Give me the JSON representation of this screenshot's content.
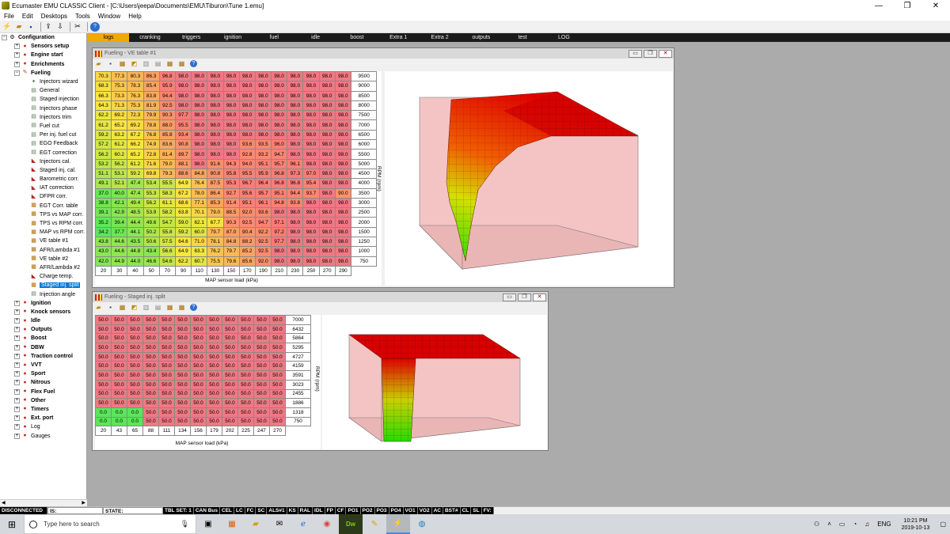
{
  "window": {
    "title": "Ecumaster EMU CLASSIC Client - [C:\\Users\\jeepa\\Documents\\EMU\\Tiburon\\Tune 1.emu]",
    "minimize": "—",
    "maximize": "❐",
    "close": "✕"
  },
  "menu": [
    "File",
    "Edit",
    "Desktops",
    "Tools",
    "Window",
    "Help"
  ],
  "tree": {
    "root": "Configuration",
    "items": [
      {
        "label": "Sensors setup",
        "bold": true,
        "level": 1,
        "icon": "sensor-icon"
      },
      {
        "label": "Engine start",
        "bold": true,
        "level": 1,
        "icon": "engine-icon"
      },
      {
        "label": "Enrichments",
        "bold": true,
        "level": 1,
        "icon": "enrich-icon"
      },
      {
        "label": "Fueling",
        "bold": true,
        "level": 1,
        "icon": "fuel-icon",
        "expanded": true
      },
      {
        "label": "Injectors wizard",
        "level": 2,
        "icon": "wand-icon"
      },
      {
        "label": "General",
        "level": 2,
        "icon": "page-icon"
      },
      {
        "label": "Staged injection",
        "level": 2,
        "icon": "page-icon"
      },
      {
        "label": "Injectors phase",
        "level": 2,
        "icon": "page-icon"
      },
      {
        "label": "Injectors trim",
        "level": 2,
        "icon": "page-icon"
      },
      {
        "label": "Fuel cut",
        "level": 2,
        "icon": "page-icon"
      },
      {
        "label": "Per inj. fuel cut",
        "level": 2,
        "icon": "page-icon"
      },
      {
        "label": "EGO Feedback",
        "level": 2,
        "icon": "page-icon"
      },
      {
        "label": "EGT correction",
        "level": 2,
        "icon": "page-icon"
      },
      {
        "label": "Injectors cal.",
        "level": 2,
        "icon": "curve-icon"
      },
      {
        "label": "Staged inj. cal.",
        "level": 2,
        "icon": "curve-icon"
      },
      {
        "label": "Barometric corr.",
        "level": 2,
        "icon": "curve-icon"
      },
      {
        "label": "IAT correction",
        "level": 2,
        "icon": "curve-icon"
      },
      {
        "label": "DFPR corr.",
        "level": 2,
        "icon": "curve-icon"
      },
      {
        "label": "EGT Corr. table",
        "level": 2,
        "icon": "table-icon"
      },
      {
        "label": "TPS vs MAP corr.",
        "level": 2,
        "icon": "table-icon"
      },
      {
        "label": "TPS vs RPM corr.",
        "level": 2,
        "icon": "table-icon"
      },
      {
        "label": "MAP vs RPM corr.",
        "level": 2,
        "icon": "table-icon"
      },
      {
        "label": "VE table #1",
        "level": 2,
        "icon": "table-icon"
      },
      {
        "label": "AFR/Lambda #1",
        "level": 2,
        "icon": "table-icon"
      },
      {
        "label": "VE table #2",
        "level": 2,
        "icon": "table-icon"
      },
      {
        "label": "AFR/Lambda #2",
        "level": 2,
        "icon": "table-icon"
      },
      {
        "label": "Charge temp.",
        "level": 2,
        "icon": "curve-icon"
      },
      {
        "label": "Staged inj. split",
        "level": 2,
        "icon": "table-icon",
        "selected": true
      },
      {
        "label": "Injection angle",
        "level": 2,
        "icon": "page-icon"
      },
      {
        "label": "Ignition",
        "bold": true,
        "level": 1,
        "icon": "spark-icon"
      },
      {
        "label": "Knock sensors",
        "bold": true,
        "level": 1,
        "icon": "knock-icon"
      },
      {
        "label": "Idle",
        "bold": true,
        "level": 1,
        "icon": "idle-icon"
      },
      {
        "label": "Outputs",
        "bold": true,
        "level": 1,
        "icon": "output-icon"
      },
      {
        "label": "Boost",
        "bold": true,
        "level": 1,
        "icon": "boost-icon"
      },
      {
        "label": "DBW",
        "bold": true,
        "level": 1,
        "icon": "dbw-icon"
      },
      {
        "label": "Traction control",
        "bold": true,
        "level": 1,
        "icon": "traction-icon"
      },
      {
        "label": "VVT",
        "bold": true,
        "level": 1,
        "icon": "vvt-icon"
      },
      {
        "label": "Sport",
        "bold": true,
        "level": 1,
        "icon": "sport-icon"
      },
      {
        "label": "Nitrous",
        "bold": true,
        "level": 1,
        "icon": "nitrous-icon"
      },
      {
        "label": "Flex Fuel",
        "bold": true,
        "level": 1,
        "icon": "flex-icon"
      },
      {
        "label": "Other",
        "bold": true,
        "level": 1,
        "icon": "other-icon"
      },
      {
        "label": "Timers",
        "bold": true,
        "level": 1,
        "icon": "timer-icon"
      },
      {
        "label": "Ext. port",
        "bold": true,
        "level": 1,
        "icon": "port-icon"
      },
      {
        "label": "Log",
        "bold": false,
        "level": 1,
        "icon": "log-icon"
      },
      {
        "label": "Gauges",
        "bold": false,
        "level": 1,
        "icon": "gauge-icon"
      }
    ]
  },
  "tabs": [
    "logs",
    "cranking",
    "triggers",
    "ignition",
    "fuel",
    "idle",
    "boost",
    "Extra 1",
    "Extra 2",
    "outputs",
    "test",
    "LOG"
  ],
  "active_tab": 0,
  "ve_window": {
    "title": "Fueling - VE table #1",
    "xlabel": "MAP sensor load (kPa)",
    "ylabel": "RPM (rpm)",
    "rpm": [
      "9500",
      "9000",
      "8500",
      "8000",
      "7500",
      "7000",
      "6500",
      "6000",
      "5500",
      "5000",
      "4500",
      "4000",
      "3500",
      "3000",
      "2500",
      "2000",
      "1500",
      "1250",
      "1000",
      "750"
    ],
    "load": [
      "20",
      "30",
      "40",
      "50",
      "70",
      "90",
      "110",
      "130",
      "150",
      "170",
      "190",
      "210",
      "230",
      "250",
      "270",
      "290"
    ],
    "rows": [
      [
        "70.3",
        "77.3",
        "80.3",
        "86.3",
        "96.8",
        "98.0",
        "98.0",
        "98.0",
        "98.0",
        "98.0",
        "98.0",
        "98.0",
        "98.0",
        "98.0",
        "98.0",
        "98.0"
      ],
      [
        "68.3",
        "75.3",
        "78.3",
        "85.4",
        "95.9",
        "98.0",
        "98.0",
        "98.0",
        "98.0",
        "98.0",
        "98.0",
        "98.0",
        "98.0",
        "98.0",
        "98.0",
        "98.0"
      ],
      [
        "66.3",
        "73.3",
        "76.3",
        "83.8",
        "94.4",
        "98.0",
        "98.0",
        "98.0",
        "98.0",
        "98.0",
        "98.0",
        "98.0",
        "98.0",
        "98.0",
        "98.0",
        "98.0"
      ],
      [
        "64.3",
        "71.3",
        "75.3",
        "81.9",
        "92.5",
        "98.0",
        "98.0",
        "98.0",
        "98.0",
        "98.0",
        "98.0",
        "98.0",
        "98.0",
        "98.0",
        "98.0",
        "98.0"
      ],
      [
        "62.2",
        "69.2",
        "72.3",
        "79.9",
        "90.3",
        "97.7",
        "98.0",
        "98.0",
        "98.0",
        "98.0",
        "98.0",
        "98.0",
        "98.0",
        "98.0",
        "98.0",
        "98.0"
      ],
      [
        "61.2",
        "65.2",
        "69.2",
        "78.8",
        "88.0",
        "95.5",
        "98.0",
        "98.0",
        "98.0",
        "98.0",
        "98.0",
        "98.0",
        "98.0",
        "98.0",
        "98.0",
        "98.0"
      ],
      [
        "59.2",
        "63.2",
        "67.2",
        "76.8",
        "85.8",
        "93.4",
        "98.0",
        "98.0",
        "98.0",
        "98.0",
        "98.0",
        "98.0",
        "98.0",
        "98.0",
        "98.0",
        "98.0"
      ],
      [
        "57.2",
        "61.2",
        "66.2",
        "74.9",
        "83.6",
        "90.8",
        "98.0",
        "98.0",
        "98.0",
        "93.6",
        "93.5",
        "96.0",
        "98.0",
        "98.0",
        "98.0",
        "98.0"
      ],
      [
        "56.2",
        "60.2",
        "65.2",
        "72.8",
        "81.4",
        "89.7",
        "98.0",
        "98.0",
        "98.0",
        "92.8",
        "93.2",
        "94.7",
        "98.0",
        "98.0",
        "98.0",
        "98.0"
      ],
      [
        "53.2",
        "56.2",
        "61.2",
        "71.6",
        "79.0",
        "88.1",
        "98.0",
        "91.6",
        "94.3",
        "94.0",
        "95.1",
        "95.7",
        "96.1",
        "98.0",
        "98.0",
        "98.0"
      ],
      [
        "51.1",
        "53.1",
        "59.2",
        "69.8",
        "79.3",
        "88.6",
        "84.8",
        "90.8",
        "95.8",
        "95.5",
        "95.9",
        "96.8",
        "97.3",
        "97.0",
        "98.0",
        "98.0"
      ],
      [
        "49.1",
        "52.1",
        "47.4",
        "53.4",
        "55.5",
        "64.9",
        "76.4",
        "87.5",
        "95.3",
        "96.7",
        "96.4",
        "96.8",
        "96.8",
        "95.4",
        "98.0",
        "98.0"
      ],
      [
        "37.0",
        "40.0",
        "47.4",
        "55.3",
        "58.3",
        "67.2",
        "78.0",
        "86.4",
        "92.7",
        "95.6",
        "95.7",
        "95.1",
        "94.4",
        "93.7",
        "98.0",
        "90.0"
      ],
      [
        "38.8",
        "42.1",
        "49.4",
        "56.2",
        "61.1",
        "68.6",
        "77.1",
        "85.3",
        "91.4",
        "95.1",
        "96.1",
        "94.8",
        "93.8",
        "98.0",
        "98.0",
        "98.0"
      ],
      [
        "39.1",
        "42.9",
        "48.5",
        "53.9",
        "58.2",
        "63.8",
        "70.1",
        "79.0",
        "88.5",
        "92.0",
        "93.6",
        "98.0",
        "98.0",
        "98.0",
        "98.0",
        "98.0"
      ],
      [
        "35.2",
        "39.4",
        "44.4",
        "49.6",
        "54.7",
        "59.0",
        "62.1",
        "67.7",
        "90.3",
        "92.5",
        "94.7",
        "97.1",
        "98.0",
        "98.0",
        "98.0",
        "98.0"
      ],
      [
        "34.2",
        "37.7",
        "44.1",
        "50.2",
        "55.8",
        "59.2",
        "60.0",
        "79.7",
        "87.0",
        "90.4",
        "92.2",
        "97.2",
        "98.0",
        "98.0",
        "98.0",
        "98.0"
      ],
      [
        "43.8",
        "44.6",
        "43.5",
        "50.6",
        "57.5",
        "64.6",
        "71.0",
        "78.1",
        "84.8",
        "88.2",
        "92.5",
        "97.7",
        "98.0",
        "98.0",
        "98.0",
        "98.0"
      ],
      [
        "43.0",
        "44.6",
        "44.8",
        "43.4",
        "56.6",
        "64.9",
        "63.3",
        "76.2",
        "79.7",
        "85.2",
        "92.5",
        "98.0",
        "98.0",
        "98.0",
        "98.0",
        "98.0"
      ],
      [
        "42.0",
        "44.9",
        "44.0",
        "46.6",
        "54.6",
        "62.2",
        "60.7",
        "75.5",
        "79.6",
        "85.6",
        "92.0",
        "98.0",
        "98.0",
        "98.0",
        "98.0",
        "98.0"
      ]
    ]
  },
  "split_window": {
    "title": "Fueling - Staged inj. split",
    "xlabel": "MAP sensor load (kPa)",
    "ylabel": "RPM (rpm)",
    "rpm": [
      "7000",
      "6432",
      "5864",
      "5295",
      "4727",
      "4159",
      "3591",
      "3023",
      "2455",
      "1886",
      "1318",
      "750"
    ],
    "load": [
      "20",
      "43",
      "65",
      "88",
      "111",
      "134",
      "156",
      "179",
      "202",
      "225",
      "247",
      "270"
    ],
    "rows": [
      [
        "50.0",
        "50.0",
        "50.0",
        "50.0",
        "50.0",
        "50.0",
        "50.0",
        "50.0",
        "50.0",
        "50.0",
        "50.0",
        "50.0"
      ],
      [
        "50.0",
        "50.0",
        "50.0",
        "50.0",
        "50.0",
        "50.0",
        "50.0",
        "50.0",
        "50.0",
        "50.0",
        "50.0",
        "50.0"
      ],
      [
        "50.0",
        "50.0",
        "50.0",
        "50.0",
        "50.0",
        "50.0",
        "50.0",
        "50.0",
        "50.0",
        "50.0",
        "50.0",
        "50.0"
      ],
      [
        "50.0",
        "50.0",
        "50.0",
        "50.0",
        "50.0",
        "50.0",
        "50.0",
        "50.0",
        "50.0",
        "50.0",
        "50.0",
        "50.0"
      ],
      [
        "50.0",
        "50.0",
        "50.0",
        "50.0",
        "50.0",
        "50.0",
        "50.0",
        "50.0",
        "50.0",
        "50.0",
        "50.0",
        "50.0"
      ],
      [
        "50.0",
        "50.0",
        "50.0",
        "50.0",
        "50.0",
        "50.0",
        "50.0",
        "50.0",
        "50.0",
        "50.0",
        "50.0",
        "50.0"
      ],
      [
        "50.0",
        "50.0",
        "50.0",
        "50.0",
        "50.0",
        "50.0",
        "50.0",
        "50.0",
        "50.0",
        "50.0",
        "50.0",
        "50.0"
      ],
      [
        "50.0",
        "50.0",
        "50.0",
        "50.0",
        "50.0",
        "50.0",
        "50.0",
        "50.0",
        "50.0",
        "50.0",
        "50.0",
        "50.0"
      ],
      [
        "50.0",
        "50.0",
        "50.0",
        "50.0",
        "50.0",
        "50.0",
        "50.0",
        "50.0",
        "50.0",
        "50.0",
        "50.0",
        "50.0"
      ],
      [
        "50.0",
        "50.0",
        "50.0",
        "50.0",
        "50.0",
        "50.0",
        "50.0",
        "50.0",
        "50.0",
        "50.0",
        "50.0",
        "50.0"
      ],
      [
        "0.0",
        "0.0",
        "0.0",
        "50.0",
        "50.0",
        "50.0",
        "50.0",
        "50.0",
        "50.0",
        "50.0",
        "50.0",
        "50.0"
      ],
      [
        "0.0",
        "0.0",
        "0.0",
        "50.0",
        "50.0",
        "50.0",
        "50.0",
        "50.0",
        "50.0",
        "50.0",
        "50.0",
        "50.0"
      ]
    ]
  },
  "status": {
    "connection": "DISCONNECTED",
    "is_label": "IS:",
    "state_label": "STATE:",
    "flags": [
      "TBL SET: 1",
      "CAN Bus",
      "CEL",
      "LC",
      "FC",
      "SC",
      "ALS#1",
      "KS",
      "RAL",
      "IDL",
      "FP",
      "CF",
      "PO1",
      "PO2",
      "PO3",
      "PO4",
      "VO1",
      "VO2",
      "AC",
      "BST#",
      "CL",
      "SL",
      "FV:"
    ]
  },
  "taskbar": {
    "search_placeholder": "Type here to search",
    "lang": "ENG",
    "time": "10:21 PM",
    "date": "2019-10-13"
  },
  "colors": {
    "tab_active": "#f2a800",
    "selection": "#0078d7"
  }
}
